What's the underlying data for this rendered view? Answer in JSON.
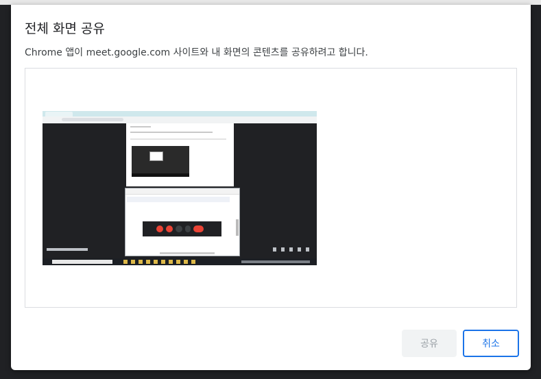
{
  "dialog": {
    "title": "전체 화면 공유",
    "description": "Chrome 앱이 meet.google.com 사이트와 내 화면의 콘텐츠를 공유하려고 합니다.",
    "buttons": {
      "share": "공유",
      "cancel": "취소"
    }
  },
  "colors": {
    "accent": "#1a73e8",
    "backdrop": "#202124",
    "hangup": "#ea4335"
  },
  "preview": {
    "icon_names": [
      "screen-thumbnail"
    ]
  }
}
